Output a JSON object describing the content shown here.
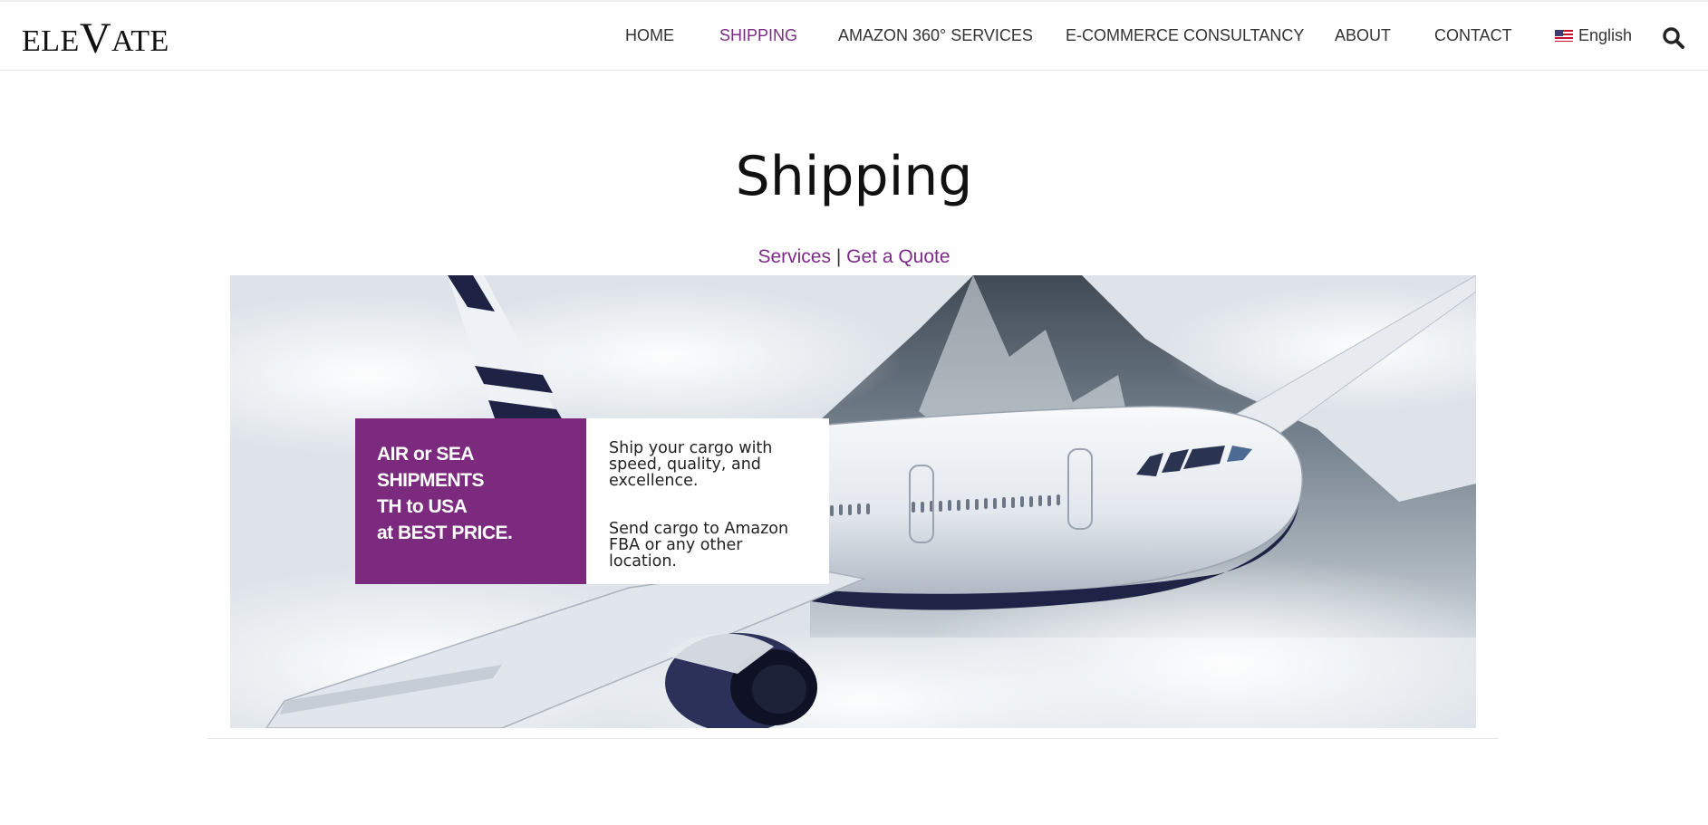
{
  "brand": {
    "logo_text_left": "ELE",
    "logo_text_v": "V",
    "logo_text_right": "ATE"
  },
  "nav": {
    "items": [
      "HOME",
      "SHIPPING",
      "AMAZON 360° SERVICES",
      "E-COMMERCE CONSULTANCY",
      "ABOUT",
      "CONTACT"
    ],
    "active": "SHIPPING",
    "language": "English",
    "search_icon": "search-icon"
  },
  "page": {
    "title": "Shipping",
    "subnav": {
      "services": "Services",
      "separator": "|",
      "quote": "Get a Quote"
    }
  },
  "promo": {
    "headline_lines": [
      "AIR or SEA",
      "SHIPMENTS",
      "TH to USA",
      "at BEST PRICE."
    ],
    "body": [
      "Ship your cargo with speed, quality, and excellence.",
      "Send cargo to Amazon FBA or any other location."
    ]
  },
  "colors": {
    "accent": "#7b2a87",
    "promo_bg": "#7b2a7e"
  }
}
